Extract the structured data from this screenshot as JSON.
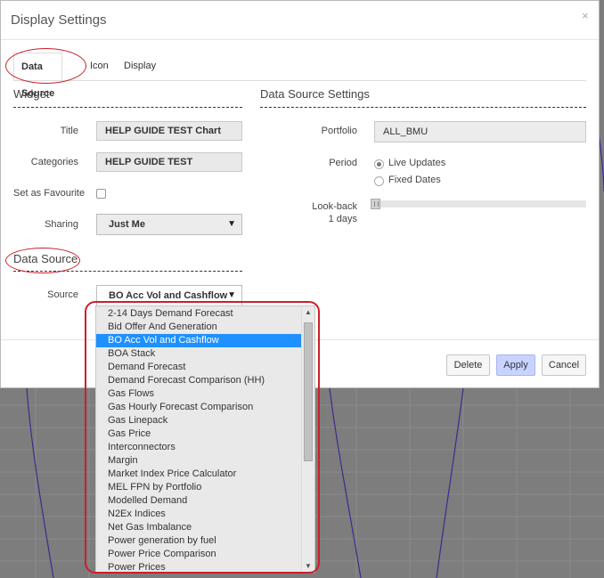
{
  "dialog": {
    "title": "Display Settings",
    "close_icon": "×"
  },
  "tabs": [
    {
      "label": "Data Source",
      "active": true
    },
    {
      "label": "Icon",
      "active": false
    },
    {
      "label": "Display",
      "active": false
    }
  ],
  "widget": {
    "section_title": "Widget",
    "title_label": "Title",
    "title_value": "HELP GUIDE TEST Chart",
    "categories_label": "Categories",
    "categories_value": "HELP GUIDE TEST",
    "favourite_label": "Set as Favourite",
    "sharing_label": "Sharing",
    "sharing_value": "Just Me",
    "caret": "▼"
  },
  "data_source": {
    "section_title": "Data Source",
    "source_label": "Source",
    "source_value": "BO Acc Vol and Cashflow",
    "options": [
      "2-14 Days Demand Forecast",
      "Bid Offer And Generation",
      "BO Acc Vol and Cashflow",
      "BOA Stack",
      "Demand Forecast",
      "Demand Forecast Comparison (HH)",
      "Gas Flows",
      "Gas Hourly Forecast Comparison",
      "Gas Linepack",
      "Gas Price",
      "Interconnectors",
      "Margin",
      "Market Index Price Calculator",
      "MEL FPN by Portfolio",
      "Modelled Demand",
      "N2Ex Indices",
      "Net Gas Imbalance",
      "Power generation by fuel",
      "Power Price Comparison",
      "Power Prices"
    ],
    "selected_index": 2
  },
  "settings": {
    "section_title": "Data Source Settings",
    "portfolio_label": "Portfolio",
    "portfolio_value": "ALL_BMU",
    "period_label": "Period",
    "period_options": [
      "Live Updates",
      "Fixed Dates"
    ],
    "period_selected": "Live Updates",
    "lookback_label": "Look-back",
    "lookback_value": "1 days"
  },
  "footer": {
    "delete_label": "Delete",
    "apply_label": "Apply",
    "cancel_label": "Cancel"
  },
  "colors": {
    "highlight_red": "#cc1f2a",
    "selected_option": "#1e90ff",
    "apply_button": "#c8d4ff"
  }
}
